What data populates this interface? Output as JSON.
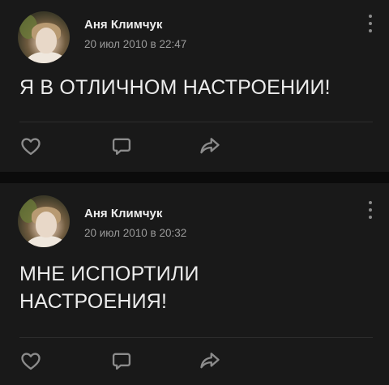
{
  "posts": [
    {
      "author": "Аня Климчук",
      "timestamp": "20 июл 2010 в 22:47",
      "text": "Я В ОТЛИЧНОМ НАСТРОЕНИИ!"
    },
    {
      "author": "Аня Климчук",
      "timestamp": "20 июл 2010 в 20:32",
      "text": "МНЕ ИСПОРТИЛИ НАСТРОЕНИЯ!"
    }
  ],
  "icons": {
    "like": "heart-icon",
    "comment": "comment-icon",
    "share": "share-icon",
    "more": "more-vertical-icon"
  },
  "colors": {
    "background": "#0b0b0b",
    "card": "#191919",
    "text": "#ececec",
    "muted": "#9a9a9a",
    "icon": "#8c8c8c"
  }
}
